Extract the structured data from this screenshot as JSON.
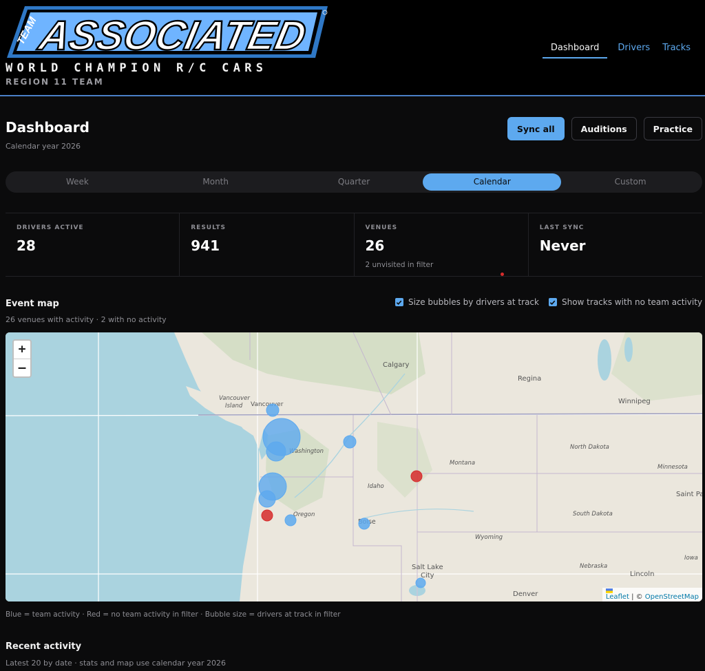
{
  "brand": {
    "logo_word": "ASSOCIATED",
    "logo_prefix": "TEAM",
    "tagline": "WORLD CHAMPION R/C CARS",
    "region": "REGION 11 TEAM"
  },
  "nav": {
    "items": [
      "Dashboard",
      "Drivers",
      "Tracks"
    ],
    "active": "Dashboard"
  },
  "page": {
    "title": "Dashboard",
    "subtitle": "Calendar year 2026"
  },
  "actions": {
    "sync_all": "Sync all",
    "auditions": "Auditions",
    "practice": "Practice"
  },
  "periods": {
    "items": [
      "Week",
      "Month",
      "Quarter",
      "Calendar",
      "Custom"
    ],
    "active": "Calendar"
  },
  "stats": [
    {
      "label": "DRIVERS ACTIVE",
      "value": "28",
      "note": ""
    },
    {
      "label": "RESULTS",
      "value": "941",
      "note": ""
    },
    {
      "label": "VENUES",
      "value": "26",
      "note": "2 unvisited in filter"
    },
    {
      "label": "LAST SYNC",
      "value": "Never",
      "note": ""
    }
  ],
  "event_map": {
    "title": "Event map",
    "subtitle": "26 venues with activity · 2 with no activity",
    "option_size": "Size bubbles by drivers at track",
    "option_show_inactive": "Show tracks with no team activity",
    "zoom_in": "+",
    "zoom_out": "–",
    "attribution_leaflet": "Leaflet",
    "attribution_sep": " | © ",
    "attribution_osm": "OpenStreetMap",
    "legend": "Blue = team activity · Red = no team activity in filter · Bubble size = drivers at track in filter",
    "colors": {
      "active": "#5da9ef",
      "inactive": "#d62c2c"
    },
    "labels": {
      "calgary": "Calgary",
      "regina": "Regina",
      "winnipeg": "Winnipeg",
      "vancouver_island_1": "Vancouver",
      "vancouver_island_2": "Island",
      "vancouver": "Vancouver",
      "washington": "Washington",
      "north_dakota": "North Dakota",
      "montana": "Montana",
      "minnesota": "Minnesota",
      "idaho": "Idaho",
      "oregon": "Oregon",
      "boise": "Boise",
      "south_dakota": "South Dakota",
      "saint_paul": "Saint Pa",
      "wyoming": "Wyoming",
      "iowa": "Iowa",
      "nebraska": "Nebraska",
      "salt_lake_1": "Salt Lake",
      "salt_lake_2": "City",
      "lincoln": "Lincoln",
      "denver": "Denver"
    }
  },
  "recent": {
    "title": "Recent activity",
    "subtitle": "Latest 20 by date · stats and map use calendar year 2026"
  }
}
